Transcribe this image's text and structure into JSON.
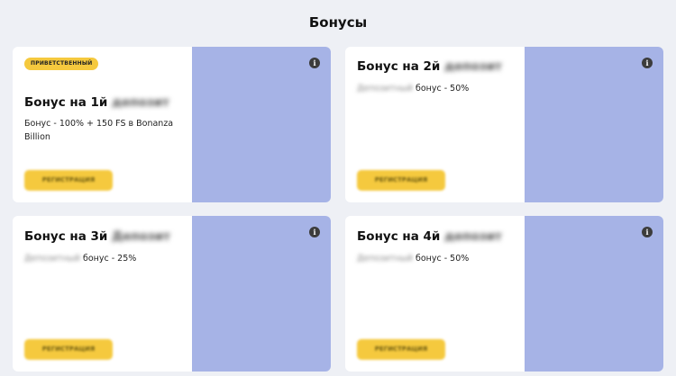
{
  "page": {
    "title": "Бонусы"
  },
  "cards": [
    {
      "badge": "ПРИВЕТСТВЕННЫЙ",
      "title_main": "Бонус на 1й",
      "title_blurred": "депозит",
      "description": "Бонус - 100% + 150 FS в Bonanza Billion",
      "button_label": "РЕГИСТРАЦИЯ",
      "info_glyph": "i"
    },
    {
      "title_main": "Бонус на 2й",
      "title_blurred": "депозит",
      "description_blurred": "Депозитный",
      "description": "бонус - 50%",
      "button_label": "РЕГИСТРАЦИЯ",
      "info_glyph": "i"
    },
    {
      "title_main": "Бонус на 3й",
      "title_blurred": "Депозит",
      "description_blurred": "Депозитный",
      "description": "бонус - 25%",
      "button_label": "РЕГИСТРАЦИЯ",
      "info_glyph": "i"
    },
    {
      "title_main": "Бонус на 4й",
      "title_blurred": "депозит",
      "description_blurred": "Депозитный",
      "description": "бонус - 50%",
      "button_label": "РЕГИСТРАЦИЯ",
      "info_glyph": "i"
    }
  ],
  "colors": {
    "background": "#eef0f5",
    "card": "#ffffff",
    "image_placeholder": "#a6b3e6",
    "accent_yellow": "#f5c93e"
  },
  "icons": {
    "info": "info-icon"
  }
}
